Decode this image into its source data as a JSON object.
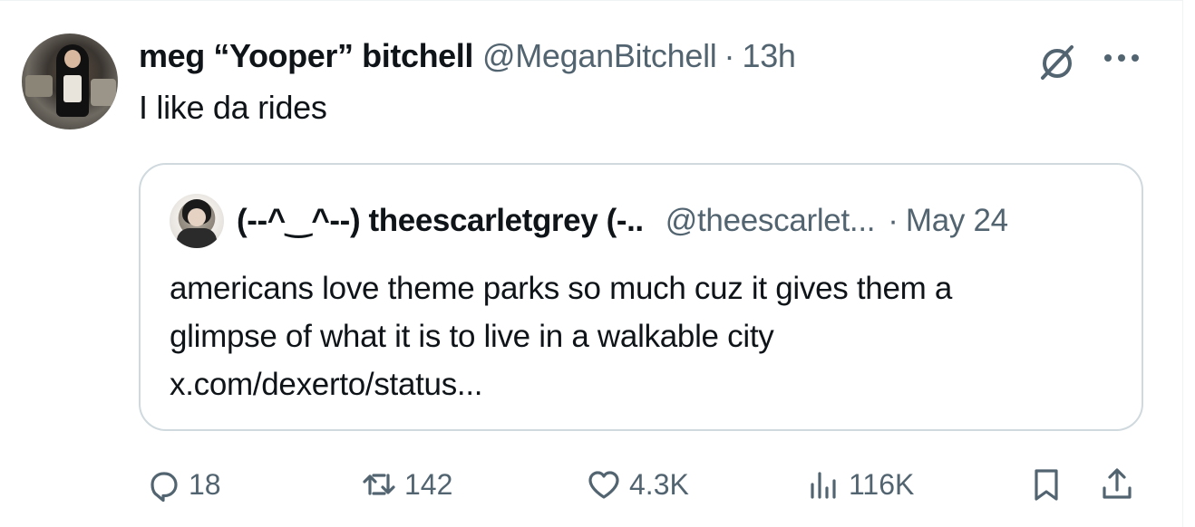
{
  "post": {
    "author": {
      "display_name": "meg “Yooper” bitchell",
      "handle": "@MeganBitchell",
      "separator": "·",
      "time": "13h"
    },
    "text": "I like da rides",
    "icons": {
      "grok": "grok-icon",
      "more": "more-options-icon"
    }
  },
  "quote": {
    "author": {
      "display_name": "(-‑^‿^‑-) theescarletgrey (-..",
      "handle": "@theescarlet...",
      "separator": "·",
      "time": "May 24"
    },
    "text_lines": [
      "americans love theme parks so much cuz it gives them a",
      "glimpse of what it is to live in a walkable city",
      "x.com/dexerto/status..."
    ]
  },
  "actions": {
    "reply": {
      "icon": "reply-icon",
      "count": "18"
    },
    "retweet": {
      "icon": "retweet-icon",
      "count": "142"
    },
    "like": {
      "icon": "heart-icon",
      "count": "4.3K"
    },
    "views": {
      "icon": "views-chart-icon",
      "count": "116K"
    },
    "bookmark": {
      "icon": "bookmark-icon"
    },
    "share": {
      "icon": "share-icon"
    }
  },
  "colors": {
    "text_primary": "#0f1419",
    "text_secondary": "#536471",
    "border": "#cfd9de"
  }
}
